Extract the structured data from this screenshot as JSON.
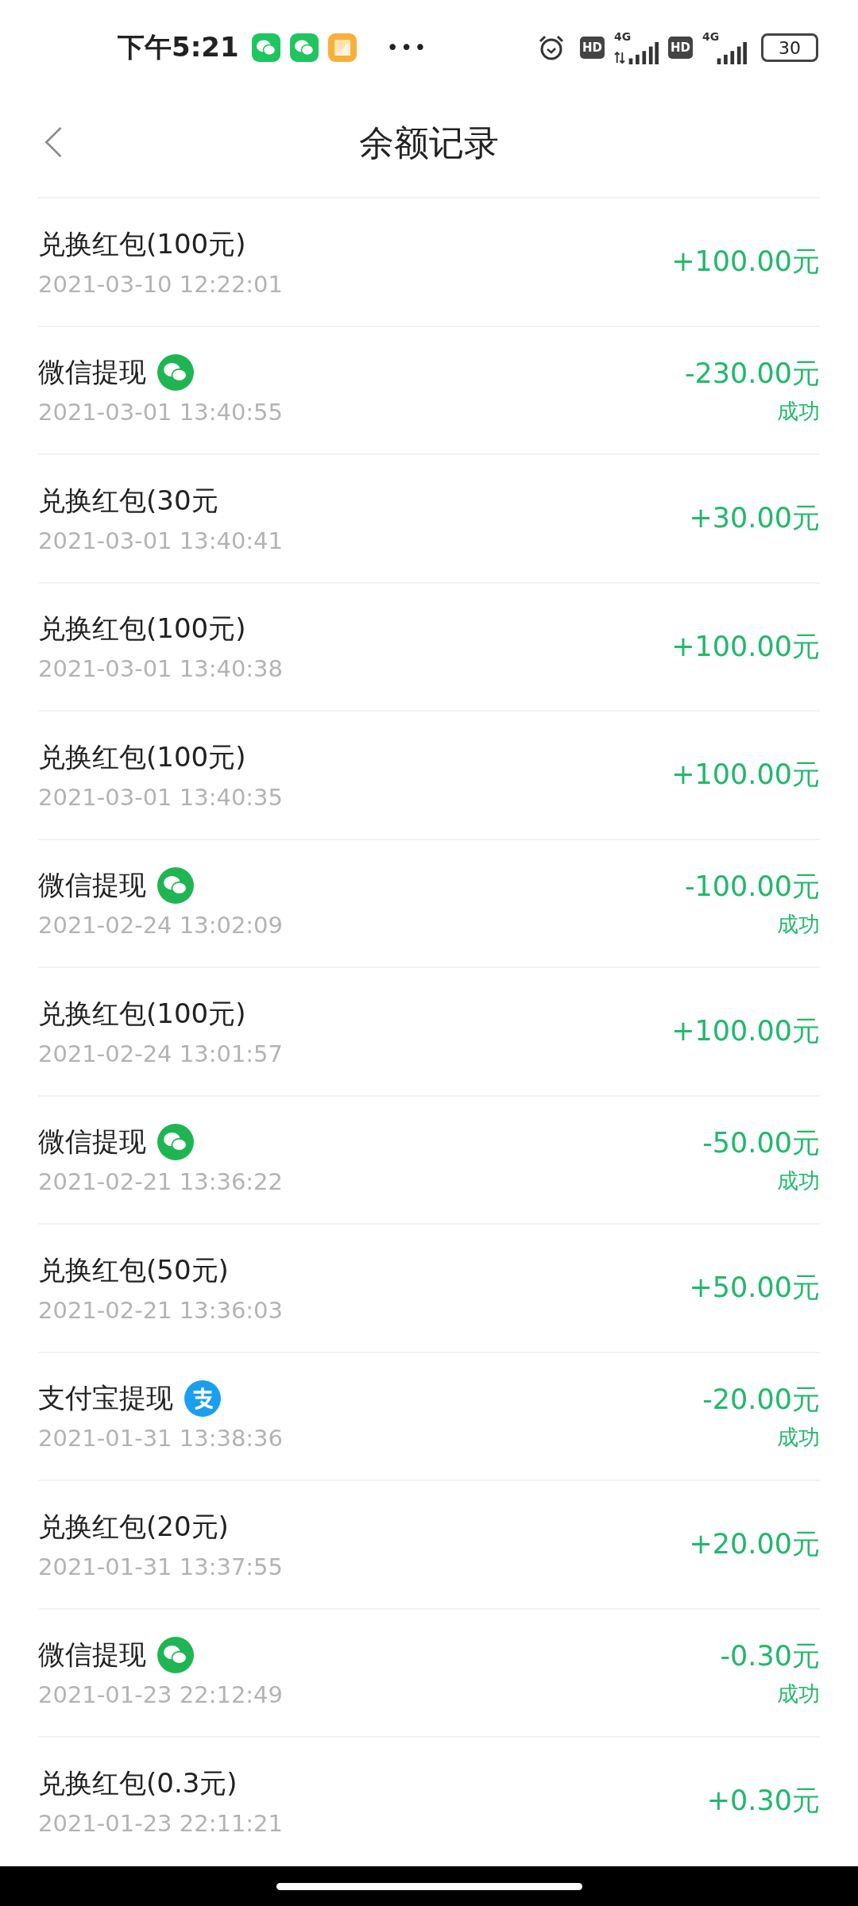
{
  "status_bar": {
    "time": "下午5:21",
    "notification_icons": [
      {
        "kind": "wechat"
      },
      {
        "kind": "wechat"
      },
      {
        "kind": "gallery"
      }
    ],
    "more": "•••",
    "sims": [
      {
        "hd": "HD",
        "network": "4G",
        "arrows": true
      },
      {
        "hd": "HD",
        "network": "4G",
        "arrows": false
      }
    ],
    "battery": "30"
  },
  "header": {
    "title": "余额记录"
  },
  "records": [
    {
      "title": "兑换红包(100元)",
      "kind": "exchange",
      "date": "2021-03-10 12:22:01",
      "amount": "+100.00元"
    },
    {
      "title": "微信提现",
      "kind": "wechat",
      "date": "2021-03-01 13:40:55",
      "amount": "-230.00元",
      "status": "成功"
    },
    {
      "title": "兑换红包(30元",
      "kind": "exchange",
      "date": "2021-03-01 13:40:41",
      "amount": "+30.00元"
    },
    {
      "title": "兑换红包(100元)",
      "kind": "exchange",
      "date": "2021-03-01 13:40:38",
      "amount": "+100.00元"
    },
    {
      "title": "兑换红包(100元)",
      "kind": "exchange",
      "date": "2021-03-01 13:40:35",
      "amount": "+100.00元"
    },
    {
      "title": "微信提现",
      "kind": "wechat",
      "date": "2021-02-24 13:02:09",
      "amount": "-100.00元",
      "status": "成功"
    },
    {
      "title": "兑换红包(100元)",
      "kind": "exchange",
      "date": "2021-02-24 13:01:57",
      "amount": "+100.00元"
    },
    {
      "title": "微信提现",
      "kind": "wechat",
      "date": "2021-02-21 13:36:22",
      "amount": "-50.00元",
      "status": "成功"
    },
    {
      "title": "兑换红包(50元)",
      "kind": "exchange",
      "date": "2021-02-21 13:36:03",
      "amount": "+50.00元"
    },
    {
      "title": "支付宝提现",
      "kind": "alipay",
      "date": "2021-01-31 13:38:36",
      "amount": "-20.00元",
      "status": "成功"
    },
    {
      "title": "兑换红包(20元)",
      "kind": "exchange",
      "date": "2021-01-31 13:37:55",
      "amount": "+20.00元"
    },
    {
      "title": "微信提现",
      "kind": "wechat",
      "date": "2021-01-23 22:12:49",
      "amount": "-0.30元",
      "status": "成功"
    },
    {
      "title": "兑换红包(0.3元)",
      "kind": "exchange",
      "date": "2021-01-23 22:11:21",
      "amount": "+0.30元"
    }
  ]
}
